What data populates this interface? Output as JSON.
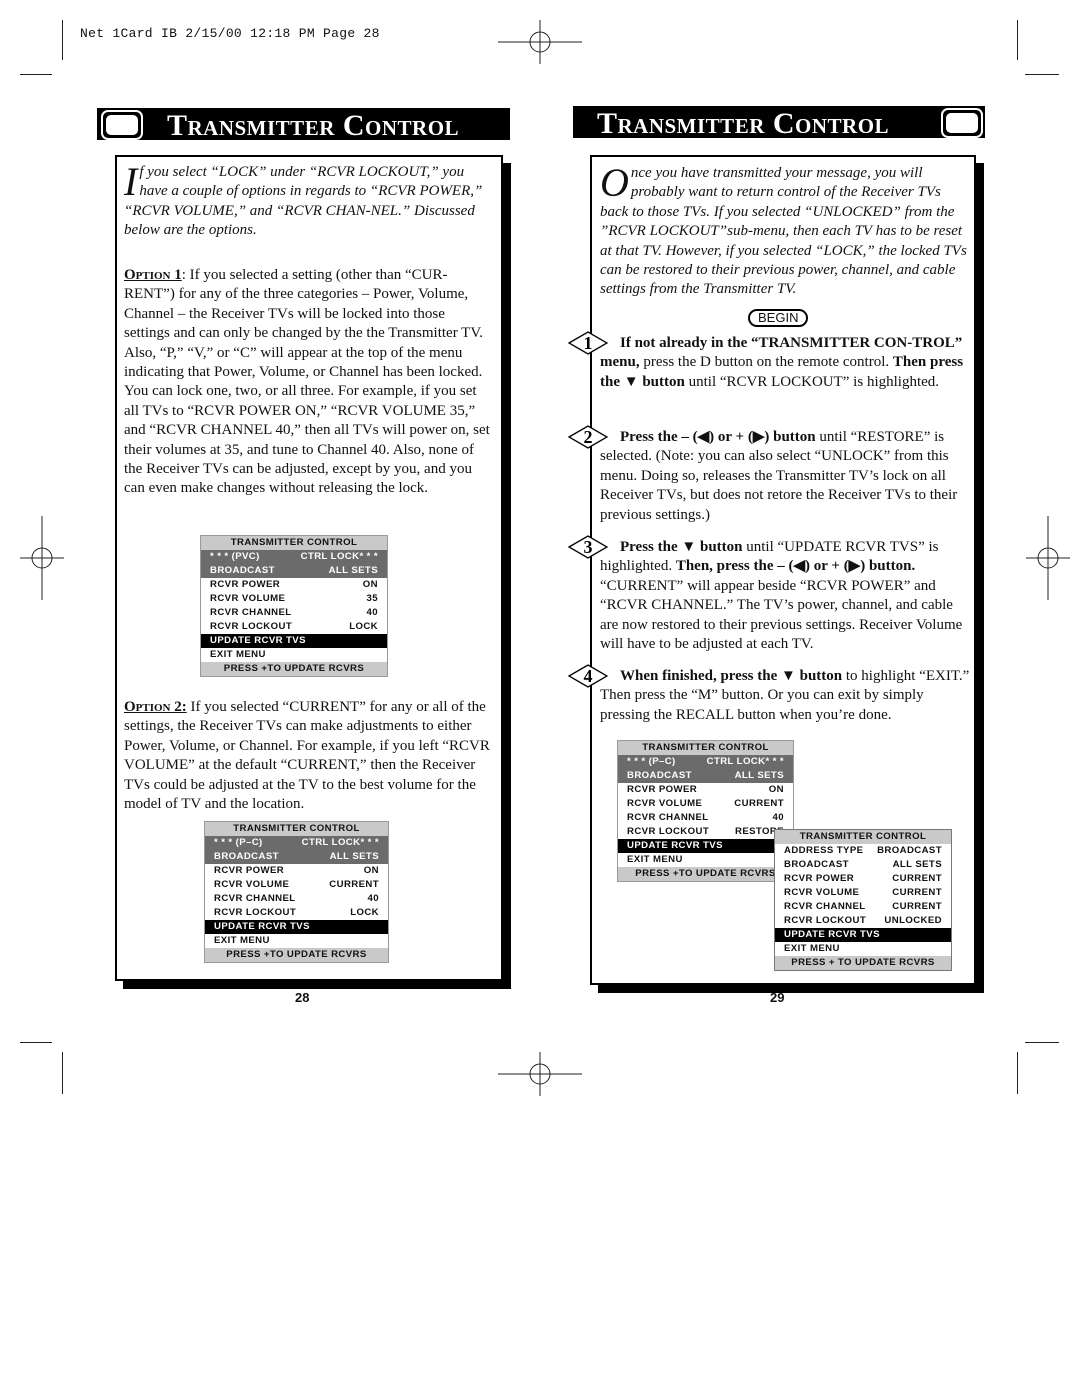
{
  "slug": "Net 1Card IB  2/15/00 12:18 PM  Page 28",
  "left": {
    "title": "Transmitter Control",
    "intro_drop": "I",
    "intro": "f you select “LOCK” under “RCVR LOCKOUT,” you have a couple of options in regards to “RCVR POWER,” “RCVR VOLUME,” and “RCVR CHAN-NEL.” Discussed below are the options.",
    "option1_label": "Option 1",
    "option1_text": ": If you selected a setting (other than “CUR-RENT”) for any of the three categories – Power, Volume, Channel –  the Receiver TVs will be locked into those settings and can only be changed by the the Transmitter TV. Also, “P,” “V,” or “C” will appear at the top of the menu indicating that Power, Volume, or Channel has been locked. You can lock one, two, or all three. For example, if you set all TVs to “RCVR POWER ON,” “RCVR VOLUME 35,” and “RCVR CHANNEL 40,” then all TVs will power on, set their volumes at 35, and tune to Channel 40. Also, none of the Receiver TVs can be adjusted, except by you, and you can even make changes without releasing the lock.",
    "option2_label": "Option 2:",
    "option2_text": " If you selected “CURRENT” for any or all of the settings, the Receiver TVs can make adjustments to either Power, Volume, or Channel. For example, if you left “RCVR VOLUME” at the default “CURRENT,” then the Receiver TVs could be adjusted at the TV to the best volume for the model of TV and the location.",
    "page_number": "28"
  },
  "right": {
    "title": "Transmitter Control",
    "intro_drop": "O",
    "intro": "nce you have transmitted your message, you will probably want to return control of the Receiver TVs back to those TVs. If you selected “UNLOCKED” from the ”RCVR LOCKOUT”sub-menu, then each TV has to be reset at that TV. However, if you selected “LOCK,” the locked TVs can be restored to their previous power, channel, and cable settings from the Transmitter TV.",
    "begin": "BEGIN",
    "steps": [
      {
        "num": "1",
        "segments": [
          {
            "b": true,
            "t": "If not already in the “TRANSMITTER CON-TROL” menu,"
          },
          {
            "b": false,
            "t": " press the D button on the remote control. "
          },
          {
            "b": true,
            "t": "Then press the ▼ button"
          },
          {
            "b": false,
            "t": " until “RCVR LOCKOUT” is highlighted."
          }
        ]
      },
      {
        "num": "2",
        "segments": [
          {
            "b": true,
            "t": "Press the – (◀) or + (▶) button"
          },
          {
            "b": false,
            "t": " until “RESTORE” is selected. (Note: you can also select “UNLOCK” from this menu. Doing so, releases the Transmitter TV’s lock on all Receiver TVs, but does not retore the Receiver TVs to their previous settings.)"
          }
        ]
      },
      {
        "num": "3",
        "segments": [
          {
            "b": true,
            "t": "Press the ▼ button"
          },
          {
            "b": false,
            "t": " until “UPDATE RCVR TVS” is highlighted. "
          },
          {
            "b": true,
            "t": "Then, press the – (◀) or + (▶) button."
          },
          {
            "b": false,
            "t": " “CURRENT” will appear beside “RCVR POWER” and “RCVR CHANNEL.” The TV’s power, channel, and cable are now restored to their previous settings. Receiver Volume will have to be adjusted at each TV."
          }
        ]
      },
      {
        "num": "4",
        "segments": [
          {
            "b": true,
            "t": "When finished, press the ▼ button"
          },
          {
            "b": false,
            "t": " to highlight “EXIT.” Then press the “M” button. Or you can exit by simply pressing the RECALL button when you’re done."
          }
        ]
      }
    ],
    "page_number": "29"
  },
  "menus": [
    {
      "rows": [
        [
          "head",
          "TRANSMITTER CONTROL",
          ""
        ],
        [
          "dark",
          "* * *  (PVC)",
          "CTRL LOCK* * *"
        ],
        [
          "dark",
          "BROADCAST",
          "ALL SETS"
        ],
        [
          "white",
          "RCVR POWER",
          "ON"
        ],
        [
          "white",
          "RCVR VOLUME",
          "35"
        ],
        [
          "white",
          "RCVR CHANNEL",
          "40"
        ],
        [
          "white",
          "RCVR LOCKOUT",
          "LOCK"
        ],
        [
          "black",
          "UPDATE RCVR TVS",
          ""
        ],
        [
          "white",
          "EXIT MENU",
          ""
        ],
        [
          "foot",
          "PRESS +TO UPDATE RCVRS",
          ""
        ]
      ]
    },
    {
      "rows": [
        [
          "head",
          "TRANSMITTER CONTROL",
          ""
        ],
        [
          "dark",
          "* * *  (P–C)",
          "CTRL LOCK* * *"
        ],
        [
          "dark",
          "BROADCAST",
          "ALL SETS"
        ],
        [
          "white",
          "RCVR POWER",
          "ON"
        ],
        [
          "white",
          "RCVR VOLUME",
          "CURRENT"
        ],
        [
          "white",
          "RCVR CHANNEL",
          "40"
        ],
        [
          "white",
          "RCVR LOCKOUT",
          "LOCK"
        ],
        [
          "black",
          "UPDATE RCVR TVS",
          ""
        ],
        [
          "white",
          "EXIT MENU",
          ""
        ],
        [
          "foot",
          "PRESS +TO UPDATE RCVRS",
          ""
        ]
      ]
    },
    {
      "rows": [
        [
          "head",
          "TRANSMITTER CONTROL",
          ""
        ],
        [
          "dark",
          "* * *  (P–C)",
          "CTRL LOCK* * *"
        ],
        [
          "dark",
          "BROADCAST",
          "ALL SETS"
        ],
        [
          "white",
          "RCVR POWER",
          "ON"
        ],
        [
          "white",
          "RCVR VOLUME",
          "CURRENT"
        ],
        [
          "white",
          "RCVR CHANNEL",
          "40"
        ],
        [
          "white",
          "RCVR LOCKOUT",
          "RESTORE"
        ],
        [
          "black",
          "UPDATE RCVR TVS",
          ""
        ],
        [
          "white",
          "EXIT MENU",
          ""
        ],
        [
          "foot",
          "PRESS +TO UPDATE RCVRS",
          ""
        ]
      ]
    },
    {
      "rows": [
        [
          "head",
          "TRANSMITTER CONTROL",
          ""
        ],
        [
          "white",
          "ADDRESS TYPE",
          "BROADCAST"
        ],
        [
          "white",
          "BROADCAST",
          "ALL SETS"
        ],
        [
          "white",
          "RCVR POWER",
          "CURRENT"
        ],
        [
          "white",
          "RCVR VOLUME",
          "CURRENT"
        ],
        [
          "white",
          "RCVR CHANNEL",
          "CURRENT"
        ],
        [
          "white",
          "RCVR LOCKOUT",
          "UNLOCKED"
        ],
        [
          "black",
          "UPDATE RCVR TVS",
          ""
        ],
        [
          "white",
          "EXIT MENU",
          ""
        ],
        [
          "foot",
          "PRESS + TO UPDATE RCVRS",
          ""
        ]
      ]
    }
  ]
}
